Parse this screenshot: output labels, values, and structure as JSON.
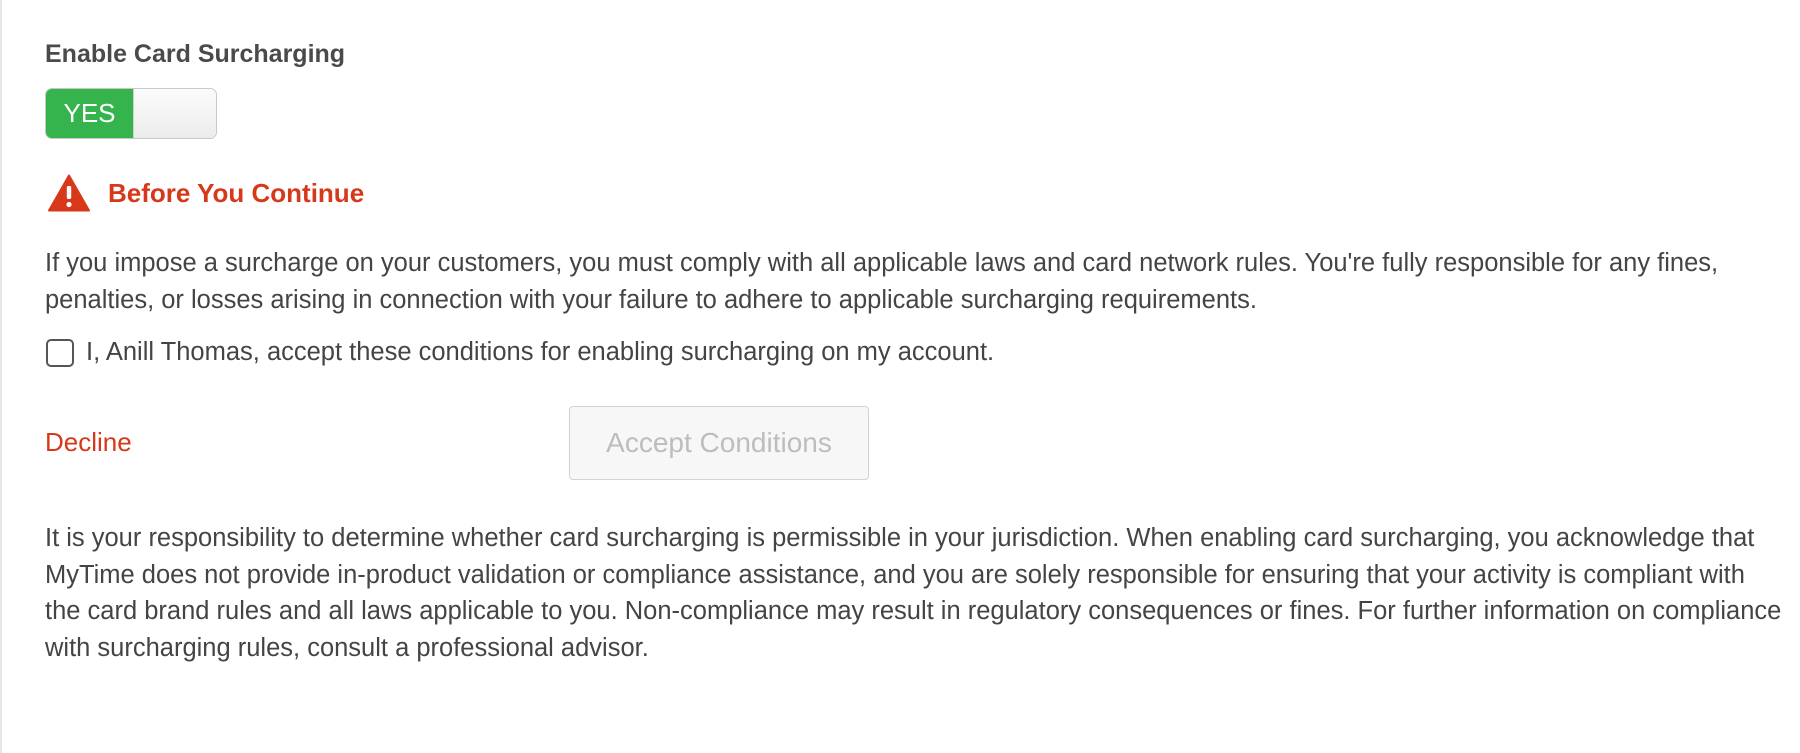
{
  "section": {
    "title": "Enable Card Surcharging"
  },
  "toggle": {
    "label_on": "YES",
    "enabled": true,
    "on_color": "#35b44e"
  },
  "warning": {
    "icon": "warning-triangle-icon",
    "title": "Before You Continue",
    "color": "#d8381a"
  },
  "notice": {
    "text": "If you impose a surcharge on your customers, you must comply with all applicable laws and card network rules. You're fully responsible for any fines, penalties, or losses arising in connection with your failure to adhere to applicable surcharging requirements."
  },
  "consent": {
    "checked": false,
    "label": "I, Anill Thomas, accept these conditions for enabling surcharging on my account."
  },
  "actions": {
    "decline_label": "Decline",
    "accept_label": "Accept Conditions",
    "accept_disabled": true
  },
  "disclaimer": {
    "text": "It is your responsibility to determine whether card surcharging is permissible in your jurisdiction. When enabling card surcharging, you acknowledge that MyTime does not provide in-product validation or compliance assistance, and you are solely responsible for ensuring that your activity is compliant with the card brand rules and all laws applicable to you. Non-compliance may result in regulatory consequences or fines. For further information on compliance with surcharging rules, consult a professional advisor."
  }
}
